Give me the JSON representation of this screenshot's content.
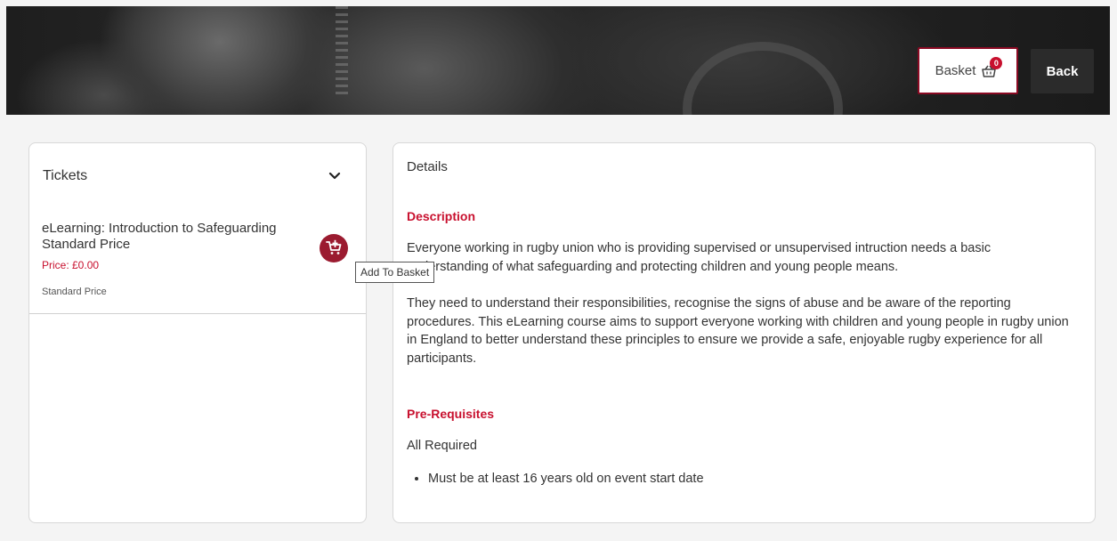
{
  "header": {
    "basket_label": "Basket",
    "basket_count": "0",
    "back_label": "Back"
  },
  "tickets": {
    "title": "Tickets",
    "items": [
      {
        "name": "eLearning: Introduction to Safeguarding Standard Price",
        "price": "Price: £0.00",
        "type": "Standard Price"
      }
    ],
    "add_tooltip": "Add To Basket"
  },
  "details": {
    "title": "Details",
    "description_heading": "Description",
    "description_p1": "Everyone working in rugby union who is providing supervised or unsupervised intruction needs a basic understanding of what safeguarding and protecting children and young people means.",
    "description_p2": "They need to understand their responsibilities, recognise the signs of abuse and be aware of the reporting procedures. This eLearning course aims to support everyone working with children and young people in rugby union in England to better understand these principles to ensure we provide a safe, enjoyable rugby experience for all participants.",
    "prereq_heading": "Pre-Requisites",
    "prereq_intro": "All Required",
    "prereq_items": [
      "Must be at least 16 years old on event start date"
    ]
  },
  "colors": {
    "brand_red": "#c8102e",
    "button_maroon": "#9b1b30",
    "back_button": "#2b2b2b"
  }
}
